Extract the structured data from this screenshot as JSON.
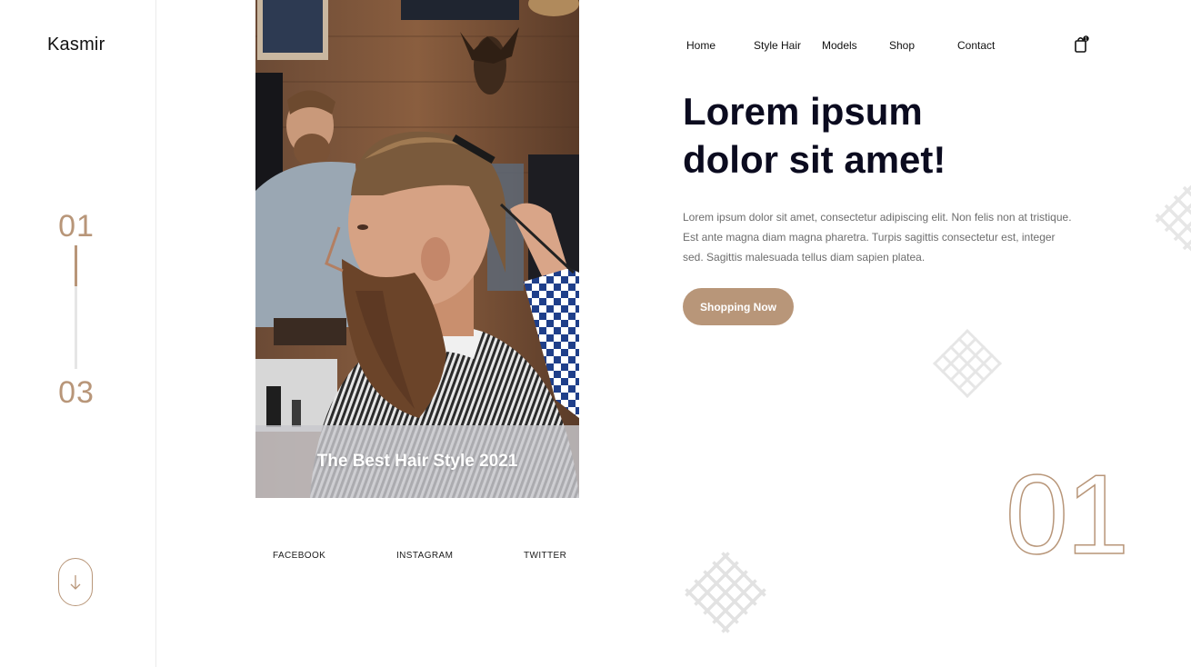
{
  "brand": {
    "logo": "Kasmir"
  },
  "slider": {
    "current": "01",
    "total": "03",
    "progress": 0.33
  },
  "sidebar": {
    "scroll_icon": "arrow-down-icon"
  },
  "hero": {
    "caption": "The Best Hair Style 2021"
  },
  "social": {
    "facebook": "FACEBOOK",
    "instagram": "INSTAGRAM",
    "twitter": "TWITTER"
  },
  "nav": {
    "home": "Home",
    "style_hair": "Style Hair",
    "models": "Models",
    "shop": "Shop",
    "contact": "Contact",
    "cart_icon": "shopping-bag-icon",
    "cart_count": "1"
  },
  "content": {
    "headline_line1": "Lorem ipsum",
    "headline_line2": "dolor sit amet!",
    "description": "Lorem ipsum dolor sit amet, consectetur adipiscing elit. Non felis non at tristique. Est ante magna diam magna pharetra. Turpis sagittis consectetur est, integer sed. Sagittis malesuada tellus diam sapien platea.",
    "cta": "Shopping Now",
    "slide_number": "01"
  },
  "colors": {
    "accent": "#b89679",
    "heading": "#0b0b1f",
    "body_text": "#6d6d6d"
  }
}
